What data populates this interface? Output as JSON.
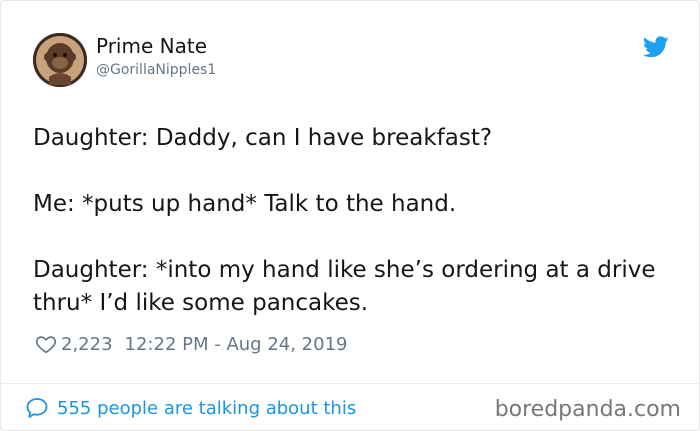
{
  "author": {
    "name": "Prime Nate",
    "handle": "@GorillaNipples1"
  },
  "tweet": {
    "lines": [
      "Daughter: Daddy, can I have breakfast?",
      "Me: *puts up hand* Talk to the hand.",
      "Daughter: *into my hand like she’s ordering at a drive thru* I’d like some pancakes."
    ],
    "likes": "2,223",
    "timestamp": "12:22 PM - Aug 24, 2019"
  },
  "footer": {
    "talking": "555 people are talking about this",
    "watermark": "boredpanda.com"
  },
  "icons": {
    "brand": "twitter-bird-icon",
    "like": "heart-icon",
    "reply": "speech-bubble-icon"
  },
  "colors": {
    "twitter_blue": "#1da1f2",
    "link_blue": "#1b95e0",
    "muted": "#657786",
    "text": "#14171a"
  }
}
